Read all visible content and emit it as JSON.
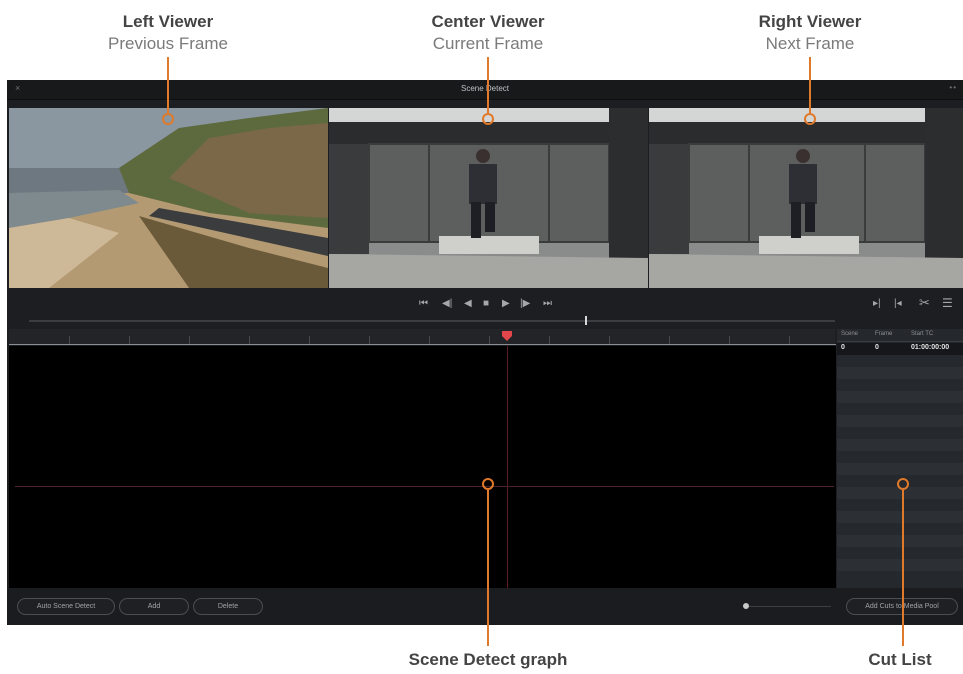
{
  "callouts": {
    "left": {
      "title": "Left Viewer",
      "subtitle": "Previous Frame"
    },
    "center": {
      "title": "Center Viewer",
      "subtitle": "Current Frame"
    },
    "right": {
      "title": "Right Viewer",
      "subtitle": "Next Frame"
    },
    "graph": "Scene Detect graph",
    "cutlist": "Cut List"
  },
  "window": {
    "title": "Scene Detect",
    "close_icon": "×",
    "more_icon": "••"
  },
  "transport": {
    "icons": [
      "skip-to-start-icon",
      "step-back-icon",
      "play-reverse-icon",
      "stop-icon",
      "play-icon",
      "step-forward-icon",
      "skip-to-end-icon"
    ],
    "right_icons": [
      "next-cut-icon",
      "prev-cut-icon",
      "cut-icon",
      "list-icon"
    ]
  },
  "cut_list": {
    "headers": [
      "Scene",
      "Frame",
      "Start TC"
    ],
    "rows": [
      {
        "scene": "0",
        "frame": "0",
        "start_tc": "01:00:00:00"
      }
    ]
  },
  "buttons": {
    "auto_detect": "Auto Scene Detect",
    "add": "Add",
    "delete": "Delete",
    "add_cuts": "Add Cuts to Media Pool"
  },
  "colors": {
    "accent": "#e07a2a",
    "playhead": "#e2464a",
    "panel": "#1c1e21"
  }
}
